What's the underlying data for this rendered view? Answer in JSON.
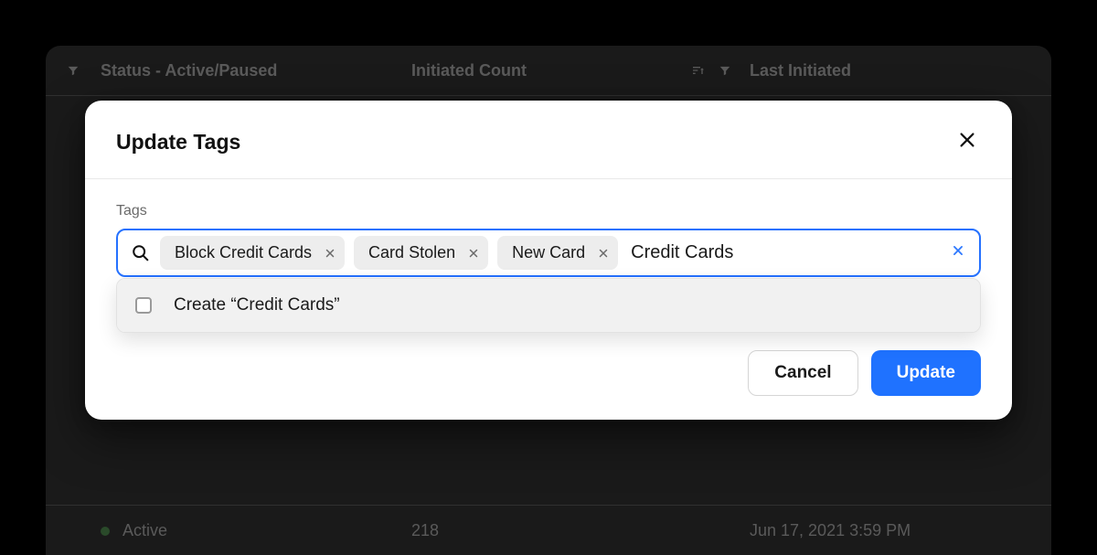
{
  "background": {
    "columns": {
      "status": "Status - Active/Paused",
      "initiated_count": "Initiated Count",
      "last_initiated": "Last Initiated"
    },
    "row": {
      "status_value": "Active",
      "initiated_value": "218",
      "last_initiated_value": "Jun 17, 2021 3:59 PM"
    }
  },
  "modal": {
    "title": "Update Tags",
    "field_label": "Tags",
    "tags": [
      {
        "label": "Block Credit Cards"
      },
      {
        "label": "Card Stolen"
      },
      {
        "label": "New Card"
      }
    ],
    "input_value": "Credit Cards",
    "dropdown": {
      "create_prefix": "Create ",
      "create_quoted": "“Credit Cards”"
    },
    "buttons": {
      "cancel": "Cancel",
      "update": "Update"
    }
  }
}
